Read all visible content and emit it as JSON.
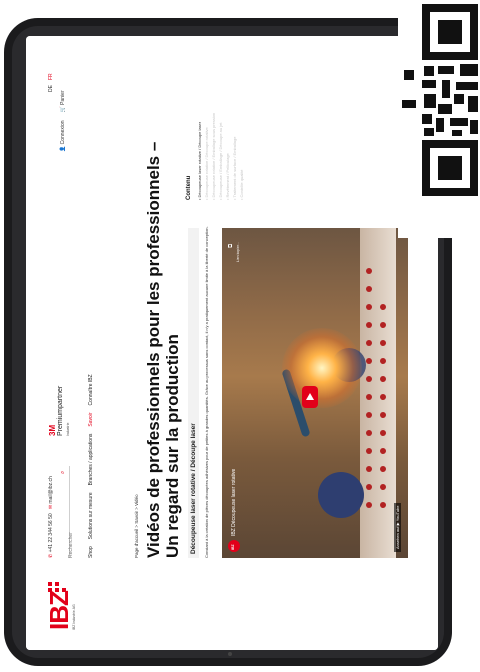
{
  "header": {
    "phone": "+41 22 344 56 50",
    "email": "mail@ibz.ch",
    "search_placeholder": "Rechercher",
    "brand_3m": "3M",
    "partner": "Premiumpartner",
    "partner_sub": "Industrie",
    "logo": "IBZ",
    "logo_sub": "IBZ Industrie AG"
  },
  "nav": {
    "items": [
      "Shop",
      "Solutions sur mesure",
      "Branches / applications",
      "Savoir",
      "Connaître IBZ"
    ],
    "active_index": 3
  },
  "util": {
    "lang_de": "DE",
    "lang_fr": "FR",
    "login": "Connexion",
    "cart": "Panier"
  },
  "content": {
    "breadcrumb": "Page d'accueil > Savoir > Vidéo",
    "title": "Vidéos de professionnels pour les professionnels – Un regard sur la production",
    "section_title": "Découpeuse laser rotative / Découpe laser",
    "paragraph": "Constant à la création de pièces découpées adhésives pour de petites à grandes quantités. Grâce au processus sans contact, il n'y a pratiquement aucune limite à la liberté de conception.",
    "sidebar_title": "Contenu",
    "sidebar_items": [
      "Découpeuse laser rotative / Découpe laser",
      "Découpeuse rotative / Découpe rotative",
      "Découpeuse rotative / Emballage sous pression",
      "Découpeuse / Emballage / Découpe au jet",
      "Revêtement / Pelliculage",
      "Traitement de surface / Emballage",
      "Contrôle qualité"
    ]
  },
  "video": {
    "channel_avatar": "IBZ",
    "title": "IBZ Découpeuse laser rotative",
    "link_label": "Lien kopier...",
    "watch_on": "Ansehen auf",
    "youtube": "YouTube"
  },
  "colors": {
    "accent": "#e2001a",
    "frame": "#1b1b1d",
    "text": "#111111"
  }
}
